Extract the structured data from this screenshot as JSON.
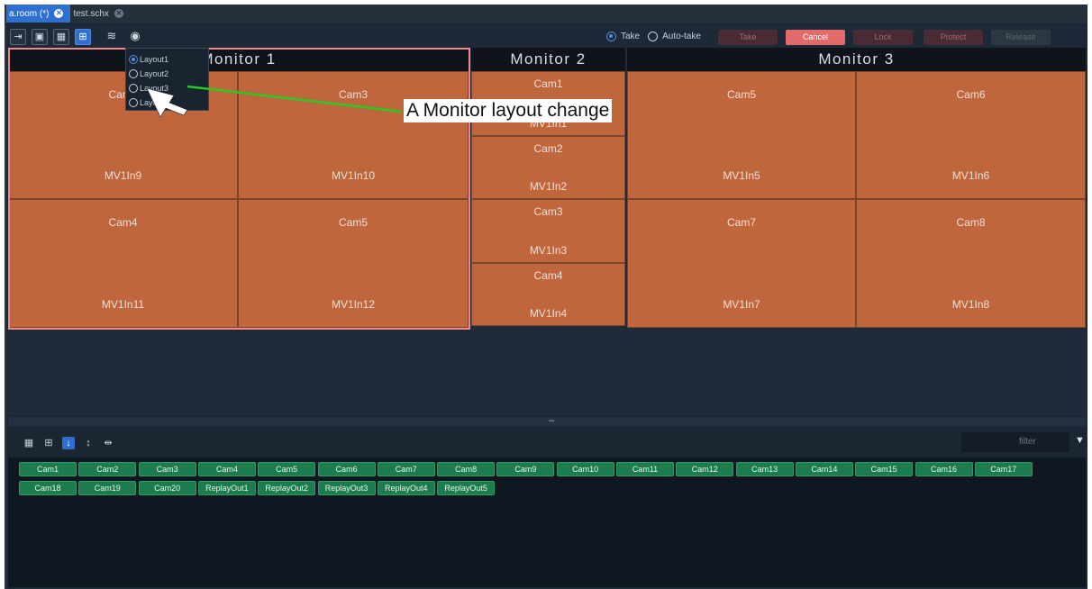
{
  "tabs": [
    {
      "label": "a.room (*)",
      "active": true
    },
    {
      "label": "test.schx",
      "active": false
    }
  ],
  "toolbar": {
    "icons": [
      "exit-icon",
      "snapshot-icon",
      "grid-icon",
      "layout-icon",
      "layers-icon",
      "settings-icon"
    ],
    "take_radio": "Take",
    "autotake_radio": "Auto-take",
    "buttons": {
      "take": "Take",
      "cancel": "Cancel",
      "lock": "Lock",
      "protect": "Protect",
      "release": "Release"
    }
  },
  "monitors": [
    {
      "title": "Monitor 1",
      "cells": [
        {
          "cam": "Cam2",
          "mv": "MV1In9"
        },
        {
          "cam": "Cam3",
          "mv": "MV1In10"
        },
        {
          "cam": "Cam4",
          "mv": "MV1In11"
        },
        {
          "cam": "Cam5",
          "mv": "MV1In12"
        }
      ]
    },
    {
      "title": "Monitor 2",
      "cells": [
        {
          "cam": "Cam1",
          "mv": "MV1In1"
        },
        {
          "cam": "Cam2",
          "mv": "MV1In2"
        },
        {
          "cam": "Cam3",
          "mv": "MV1In3"
        },
        {
          "cam": "Cam4",
          "mv": "MV1In4"
        }
      ]
    },
    {
      "title": "Monitor 3",
      "cells": [
        {
          "cam": "Cam5",
          "mv": "MV1In5"
        },
        {
          "cam": "Cam6",
          "mv": "MV1In6"
        },
        {
          "cam": "Cam7",
          "mv": "MV1In7"
        },
        {
          "cam": "Cam8",
          "mv": "MV1In8"
        }
      ]
    }
  ],
  "layout_menu": [
    "Layout1",
    "Layout2",
    "Layout3",
    "Layout4"
  ],
  "layout_selected": "Layout1",
  "annotation": "A Monitor layout change",
  "bottom": {
    "filter_placeholder": "filter",
    "sources_row1": [
      "Cam1",
      "Cam2",
      "Cam3",
      "Cam4",
      "Cam5",
      "Cam6",
      "Cam7",
      "Cam8",
      "Cam9",
      "Cam10",
      "Cam11",
      "Cam12",
      "Cam13",
      "Cam14",
      "Cam15",
      "Cam16",
      "Cam17"
    ],
    "sources_row2": [
      "Cam18",
      "Cam19",
      "Cam20",
      "ReplayOut1",
      "ReplayOut2",
      "ReplayOut3",
      "ReplayOut4",
      "ReplayOut5"
    ]
  },
  "colors": {
    "accent": "#2f6fd0",
    "cell": "#c0663c",
    "source": "#1d7c4e",
    "cancel": "#e26a6a",
    "annotation_line": "#22cc22"
  }
}
